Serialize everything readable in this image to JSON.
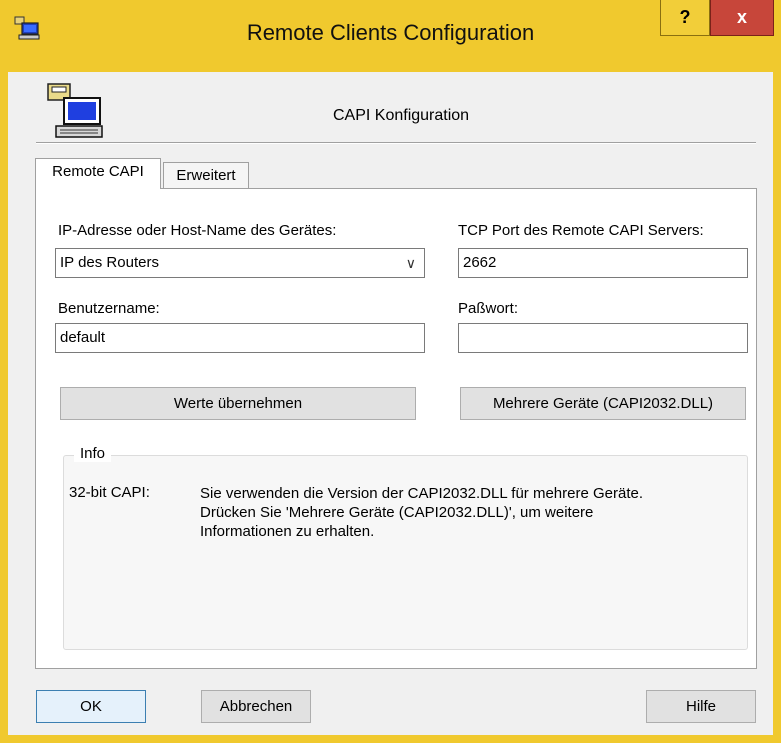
{
  "window": {
    "title": "Remote Clients Configuration",
    "help_label": "?",
    "close_label": "x"
  },
  "header": {
    "caption": "CAPI Konfiguration"
  },
  "tabs": [
    {
      "label": "Remote CAPI",
      "active": true
    },
    {
      "label": "Erweitert",
      "active": false
    }
  ],
  "form": {
    "host_label": "IP-Adresse oder Host-Name des Gerätes:",
    "host_value": "IP des Routers",
    "port_label": "TCP Port des Remote CAPI Servers:",
    "port_value": "2662",
    "user_label": "Benutzername:",
    "user_value": "default",
    "password_label": "Paßwort:",
    "password_value": "",
    "apply_label": "Werte übernehmen",
    "multi_label": "Mehrere Geräte (CAPI2032.DLL)"
  },
  "info": {
    "title": "Info",
    "key": "32-bit CAPI:",
    "line1": "Sie verwenden die Version der CAPI2032.DLL für mehrere Geräte.",
    "line2": "Drücken Sie 'Mehrere Geräte (CAPI2032.DLL)', um weitere",
    "line3": "Informationen zu erhalten."
  },
  "buttons": {
    "ok": "OK",
    "cancel": "Abbrechen",
    "help": "Hilfe"
  },
  "colors": {
    "titlebar": "#f0c92e",
    "close": "#c7463a",
    "dialog_bg": "#f0f0f0"
  }
}
